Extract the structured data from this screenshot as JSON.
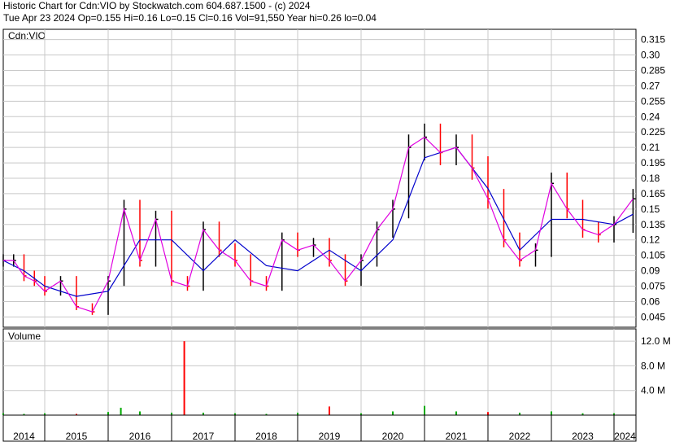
{
  "header": {
    "line1": "Historic Chart for Cdn:VIO by Stockwatch.com 604.687.1500 - (c) 2024",
    "line2": "Tue Apr 23 2024  Op=0.155  Hi=0.16  Lo=0.15  Cl=0.16  Vol=91,550  Year hi=0.26  lo=0.04"
  },
  "colors": {
    "price_bar": "#000000",
    "down_bar": "#ff0000",
    "ma_short": "#e000e0",
    "ma_long": "#0000cc",
    "volume_up": "#00aa00",
    "volume_down": "#ff0000",
    "grid": "#c8c8c8"
  },
  "chart_data": [
    {
      "type": "ohlc",
      "title": "Cdn:VIO",
      "ylim": [
        0.035,
        0.325
      ],
      "y_ticks": [
        "0.315",
        "0.30",
        "0.285",
        "0.27",
        "0.255",
        "0.24",
        "0.225",
        "0.21",
        "0.195",
        "0.18",
        "0.165",
        "0.15",
        "0.135",
        "0.12",
        "0.105",
        "0.09",
        "0.075",
        "0.06",
        "0.045"
      ],
      "x_ticks": [
        "2014",
        "2015",
        "2016",
        "2017",
        "2018",
        "2019",
        "2020",
        "2021",
        "2022",
        "2023",
        "2024"
      ],
      "grid": true,
      "series": [
        {
          "name": "",
          "x": [
            2014.0,
            2014.25,
            2014.5,
            2014.75,
            2015.0,
            2015.25,
            2015.5,
            2015.75,
            2016.0,
            2016.25,
            2016.5,
            2016.75,
            2017.0,
            2017.25,
            2017.5,
            2017.75,
            2018.0,
            2018.25,
            2018.5,
            2018.75,
            2019.0,
            2019.25,
            2019.5,
            2019.75,
            2020.0,
            2020.25,
            2020.5,
            2020.75,
            2021.0,
            2021.25,
            2021.5,
            2021.75,
            2022.0,
            2022.25,
            2022.5,
            2022.75,
            2023.0,
            2023.25,
            2023.5,
            2023.75,
            2024.0,
            2024.3
          ],
          "y": [
            0.1,
            0.1,
            0.085,
            0.08,
            0.07,
            0.08,
            0.055,
            0.05,
            0.08,
            0.15,
            0.1,
            0.14,
            0.08,
            0.075,
            0.13,
            0.11,
            0.1,
            0.08,
            0.075,
            0.12,
            0.11,
            0.115,
            0.1,
            0.08,
            0.1,
            0.13,
            0.15,
            0.21,
            0.22,
            0.205,
            0.21,
            0.19,
            0.16,
            0.12,
            0.1,
            0.11,
            0.175,
            0.15,
            0.13,
            0.125,
            0.135,
            0.16
          ]
        },
        {
          "name": "",
          "x": [
            2014.0,
            2014.5,
            2015.0,
            2015.5,
            2016.0,
            2016.5,
            2017.0,
            2017.5,
            2018.0,
            2018.5,
            2019.0,
            2019.5,
            2020.0,
            2020.5,
            2021.0,
            2021.5,
            2022.0,
            2022.5,
            2023.0,
            2023.5,
            2024.0,
            2024.3
          ],
          "y": [
            0.1,
            0.09,
            0.075,
            0.065,
            0.07,
            0.12,
            0.12,
            0.09,
            0.12,
            0.095,
            0.09,
            0.11,
            0.09,
            0.12,
            0.2,
            0.21,
            0.17,
            0.11,
            0.14,
            0.14,
            0.135,
            0.145
          ]
        }
      ]
    },
    {
      "type": "bar",
      "title": "Volume",
      "ylim": [
        0,
        14
      ],
      "y_ticks": [
        "12.0 M",
        "8.0 M",
        "4.0 M"
      ],
      "x": [
        2014.0,
        2014.5,
        2015.0,
        2015.5,
        2016.0,
        2016.2,
        2016.5,
        2017.0,
        2017.2,
        2017.5,
        2018.0,
        2018.5,
        2019.0,
        2019.5,
        2020.0,
        2020.5,
        2021.0,
        2021.5,
        2022.0,
        2022.5,
        2023.0,
        2023.5,
        2024.0
      ],
      "values": [
        0.3,
        0.2,
        0.3,
        0.2,
        0.5,
        1.2,
        0.6,
        0.4,
        12.0,
        0.4,
        0.3,
        0.2,
        0.4,
        1.4,
        0.3,
        0.6,
        1.5,
        0.6,
        0.5,
        0.4,
        0.6,
        0.3,
        0.3
      ]
    }
  ]
}
